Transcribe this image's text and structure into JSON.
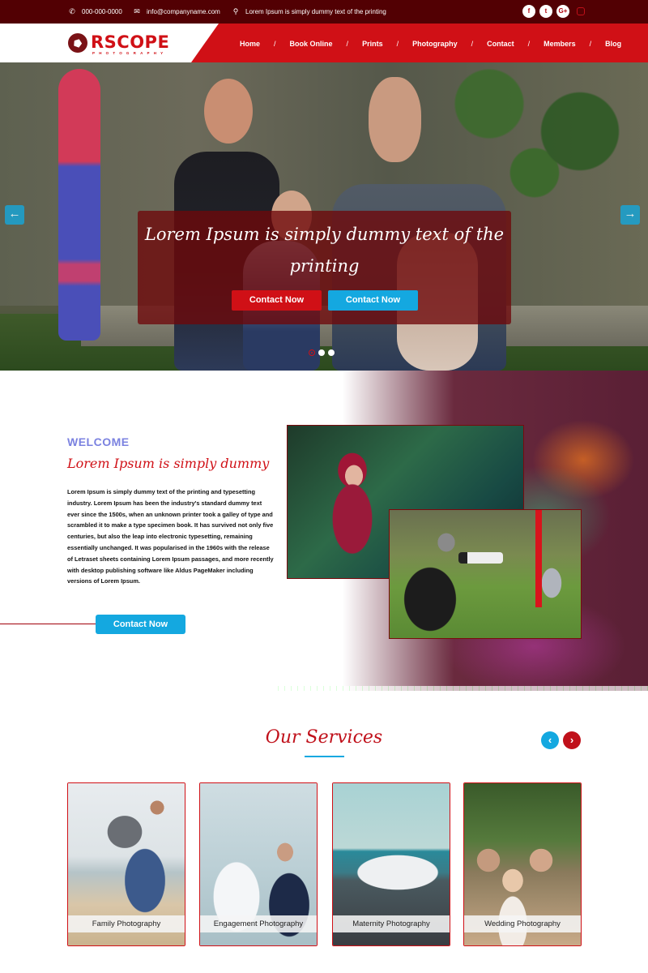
{
  "topbar": {
    "phone": "000-000-0000",
    "email": "info@companyname.com",
    "address": "Lorem Ipsum is simply dummy text of the printing",
    "social": [
      "f",
      "t",
      "G+"
    ]
  },
  "header": {
    "logo_text": "RSCOPE",
    "logo_subtext": "PHOTOGRAPHY",
    "nav": [
      {
        "label": "Home"
      },
      {
        "label": "Book Online"
      },
      {
        "label": "Prints"
      },
      {
        "label": "Photography"
      },
      {
        "label": "Contact"
      },
      {
        "label": "Members"
      },
      {
        "label": "Blog"
      }
    ],
    "separator": "/"
  },
  "hero": {
    "title": "Lorem Ipsum is simply dummy text of the printing",
    "button_primary": "Contact Now",
    "button_secondary": "Contact Now",
    "arrow_left": "←",
    "arrow_right": "→",
    "slides": 3,
    "active_slide": 1
  },
  "welcome": {
    "label": "WELCOME",
    "title": "Lorem Ipsum is simply dummy",
    "body": "Lorem Ipsum is simply dummy text of the printing and typesetting industry. Lorem Ipsum has been the industry's standard dummy text ever since the 1500s, when an unknown printer took a galley of type and scrambled it to make a type specimen book. It has survived not only five centuries, but also the leap into electronic typesetting, remaining essentially unchanged. It was popularised in the 1960s with the release of Letraset sheets containing Lorem Ipsum passages, and more recently with desktop publishing software like Aldus PageMaker including versions of Lorem Ipsum.",
    "button": "Contact Now"
  },
  "services": {
    "title": "Our Services",
    "prev": "‹",
    "next": "›",
    "items": [
      {
        "label": "Family Photography"
      },
      {
        "label": "Engagement Photography"
      },
      {
        "label": "Maternity Photography"
      },
      {
        "label": "Wedding Photography"
      }
    ]
  },
  "colors": {
    "brand_red": "#d01016",
    "dark_red": "#520003",
    "accent_blue": "#14a8e0",
    "welcome_label": "#7b82e0"
  }
}
